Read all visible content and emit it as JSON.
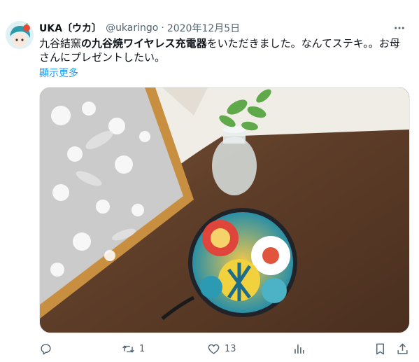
{
  "user": {
    "name": "UKA〔ウカ〕",
    "handle": "@ukaringo",
    "date": "2020年12月5日"
  },
  "tweet": {
    "text_part1": "九谷結窯",
    "text_bold": "の九谷焼ワイヤレス充電器",
    "text_part2": "をいただきました。なんてステキ。。お母さんにプレゼントしたい。",
    "show_more": "顯示更多"
  },
  "actions": {
    "reply_count": "",
    "retweet_count": "1",
    "like_count": "13",
    "views_count": ""
  },
  "colors": {
    "link": "#1d9bf0",
    "muted": "#536471",
    "text": "#0f1419"
  },
  "icons": [
    "more-icon",
    "reply-icon",
    "retweet-icon",
    "like-icon",
    "views-icon",
    "bookmark-icon",
    "share-icon"
  ]
}
